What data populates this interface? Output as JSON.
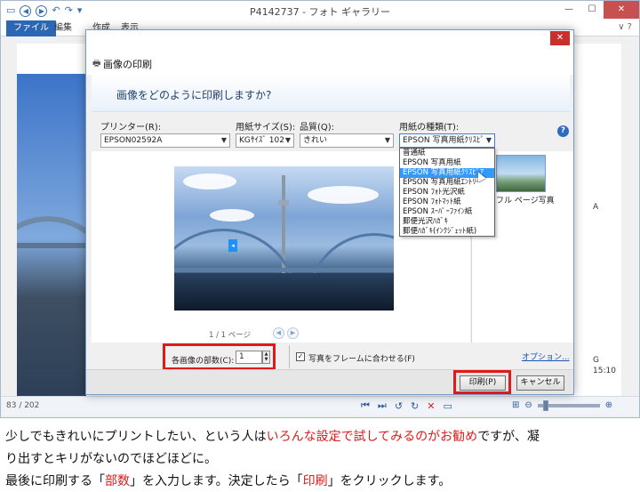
{
  "window": {
    "title": "P4142737 - フォト ギャラリー",
    "minimize": "—",
    "maximize": "☐",
    "close": "✕"
  },
  "ribbon": {
    "tabs": [
      "ファイル",
      "編集",
      "作成",
      "表示"
    ],
    "help": "∨ ?"
  },
  "viewer": {
    "info_line1": "A",
    "info_line2": "G",
    "info_line3": "15:10"
  },
  "statusbar": {
    "count": "83 / 202"
  },
  "dialog": {
    "title": "画像の印刷",
    "question": "画像をどのように印刷しますか?",
    "close": "✕",
    "printer": {
      "label": "プリンター(R):",
      "value": "EPSON02592A"
    },
    "paper_size": {
      "label": "用紙サイズ(S):",
      "value": "KGｻｲｽﾞ 102"
    },
    "quality": {
      "label": "品質(Q):",
      "value": "きれい"
    },
    "paper_type": {
      "label": "用紙の種類(T):",
      "value": "EPSON 写真用紙ｸﾘｽﾋﾟ",
      "options": [
        "普通紙",
        "EPSON 写真用紙",
        "EPSON 写真用紙ｸﾘｽﾋﾟｱ",
        "EPSON 写真用紙ｴﾝﾄﾘｰ",
        "EPSON ﾌｫﾄ光沢紙",
        "EPSON ﾌｫﾄﾏｯﾄ紙",
        "EPSON ｽｰﾊﾟｰﾌｧｲﾝ紙",
        "郵便光沢ﾊｶﾞｷ",
        "郵便ﾊｶﾞｷ(ｲﾝｸｼﾞｪｯﾄ紙)"
      ],
      "selected_index": 2
    },
    "help": "?",
    "page_info": "1 / 1 ページ",
    "thumbnail_label": "フル ページ写真",
    "copies": {
      "label": "各画像の部数(C):",
      "value": "1"
    },
    "fit_frame": {
      "label": "写真をフレームに合わせる(F)",
      "checked": true
    },
    "options_link": "オプション...",
    "print_button": "印刷(P)",
    "cancel_button": "キャンセル"
  },
  "caption": {
    "line1_a": "少しでもきれいにプリントしたい、という人は",
    "line1_red": "いろんな設定で試してみるのがお勧め",
    "line1_b": "ですが、凝",
    "line2": "り出すとキリがないのでほどほどに。",
    "line3_a": "最後に印刷する「",
    "line3_red1": "部数",
    "line3_b": "」を入力します。決定したら「",
    "line3_red2": "印刷",
    "line3_c": "」をクリックします。"
  },
  "colors": {
    "highlight": "#e0191b",
    "accent": "#2b67b4",
    "selection": "#3399ff"
  }
}
